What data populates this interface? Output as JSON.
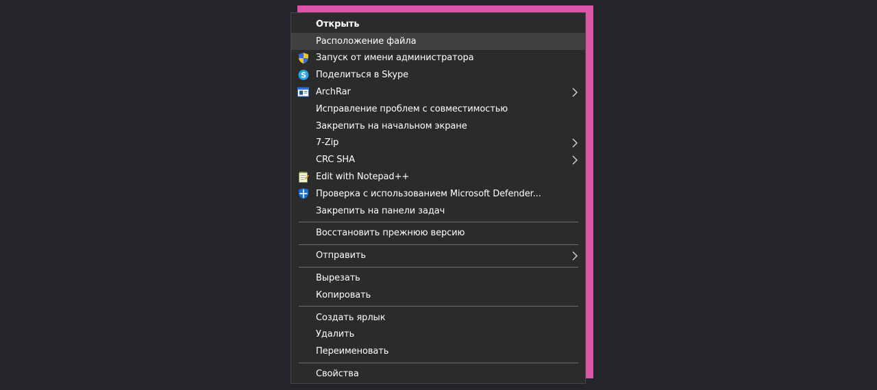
{
  "colors": {
    "background": "#24242b",
    "accent": "#d855a8",
    "menu_background": "#2b2b2b",
    "menu_hover": "#414141",
    "separator": "#6d6d6d",
    "text": "#ffffff"
  },
  "menu": {
    "groups": [
      {
        "items": [
          {
            "label": "Открыть",
            "bold": true
          },
          {
            "label": "Расположение файла",
            "highlighted": true
          },
          {
            "label": "Запуск от имени администратора",
            "icon": "uac-shield-icon"
          },
          {
            "label": "Поделиться в Skype",
            "icon": "skype-icon"
          },
          {
            "label": "ArchRar",
            "icon": "archive-icon",
            "submenu": true
          },
          {
            "label": "Исправление проблем с совместимостью"
          },
          {
            "label": "Закрепить на начальном экране"
          },
          {
            "label": "7-Zip",
            "submenu": true
          },
          {
            "label": "CRC SHA",
            "submenu": true
          },
          {
            "label": "Edit with Notepad++",
            "icon": "notepad-plus-plus-icon"
          },
          {
            "label": "Проверка с использованием Microsoft Defender...",
            "icon": "defender-shield-icon"
          },
          {
            "label": "Закрепить на панели задач"
          }
        ]
      },
      {
        "items": [
          {
            "label": "Восстановить прежнюю версию"
          }
        ]
      },
      {
        "items": [
          {
            "label": "Отправить",
            "submenu": true
          }
        ]
      },
      {
        "items": [
          {
            "label": "Вырезать"
          },
          {
            "label": "Копировать"
          }
        ]
      },
      {
        "items": [
          {
            "label": "Создать ярлык"
          },
          {
            "label": "Удалить"
          },
          {
            "label": "Переименовать"
          }
        ]
      },
      {
        "items": [
          {
            "label": "Свойства"
          }
        ]
      }
    ]
  }
}
